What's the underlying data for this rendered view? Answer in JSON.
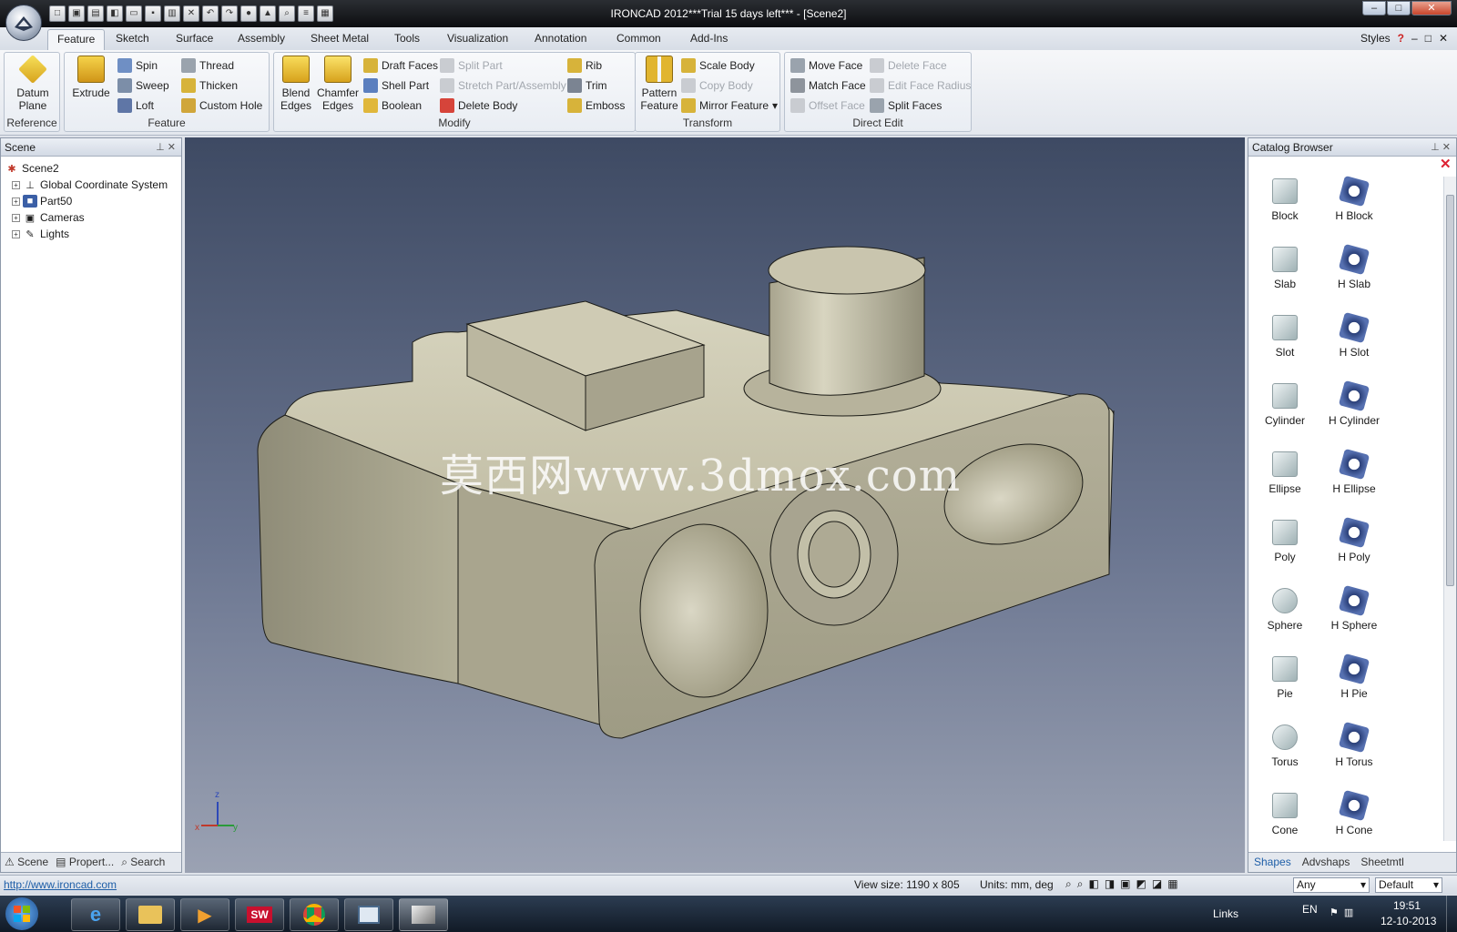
{
  "title_bar": {
    "title": "IRONCAD 2012***Trial 15 days left*** - [Scene2]"
  },
  "tabs": [
    "Feature",
    "Sketch",
    "Surface",
    "Assembly",
    "Sheet Metal",
    "Tools",
    "Visualization",
    "Annotation",
    "Common",
    "Add-Ins"
  ],
  "styles_label": "Styles",
  "ribbon": {
    "reference": {
      "label": "Reference",
      "datum1": "Datum",
      "datum2": "Plane"
    },
    "feature": {
      "label": "Feature",
      "extrude": "Extrude",
      "spin": "Spin",
      "sweep": "Sweep",
      "loft": "Loft",
      "thread": "Thread",
      "thicken": "Thicken",
      "custom_hole": "Custom Hole"
    },
    "modify": {
      "label": "Modify",
      "blend1": "Blend",
      "blend2": "Edges",
      "chamfer1": "Chamfer",
      "chamfer2": "Edges",
      "draft_faces": "Draft Faces",
      "shell_part": "Shell Part",
      "boolean": "Boolean",
      "split_part": "Split Part",
      "stretch": "Stretch Part/Assembly",
      "delete_body": "Delete Body",
      "rib": "Rib",
      "trim": "Trim",
      "emboss": "Emboss"
    },
    "transform": {
      "label": "Transform",
      "pattern1": "Pattern",
      "pattern2": "Feature",
      "scale_body": "Scale Body",
      "copy_body": "Copy Body",
      "mirror": "Mirror Feature"
    },
    "direct_edit": {
      "label": "Direct Edit",
      "move_face": "Move Face",
      "match_face": "Match Face",
      "offset_face": "Offset Face",
      "delete_face": "Delete Face",
      "edit_radius": "Edit Face Radius",
      "split_faces": "Split Faces"
    }
  },
  "scene_panel": {
    "title": "Scene",
    "tree": {
      "root": "Scene2",
      "children": [
        "Global Coordinate System",
        "Part50",
        "Cameras",
        "Lights"
      ]
    },
    "tabs": [
      "Scene",
      "Propert...",
      "Search"
    ]
  },
  "viewport": {
    "watermark": "莫西网www.3dmox.com",
    "axis_z": "z",
    "axis_x": "x",
    "axis_y": "y"
  },
  "catalog": {
    "title": "Catalog Browser",
    "items": [
      [
        "Block",
        "H Block"
      ],
      [
        "Slab",
        "H Slab"
      ],
      [
        "Slot",
        "H Slot"
      ],
      [
        "Cylinder",
        "H Cylinder"
      ],
      [
        "Ellipse",
        "H Ellipse"
      ],
      [
        "Poly",
        "H Poly"
      ],
      [
        "Sphere",
        "H Sphere"
      ],
      [
        "Pie",
        "H Pie"
      ],
      [
        "Torus",
        "H Torus"
      ],
      [
        "Cone",
        "H Cone"
      ]
    ],
    "tabs": [
      "Shapes",
      "Advshaps",
      "Sheetmtl"
    ]
  },
  "statusbar": {
    "url": "http://www.ironcad.com",
    "view_size": "View size: 1190 x 805",
    "units": "Units: mm, deg",
    "select_any": "Any",
    "select_default": "Default"
  },
  "taskbar": {
    "links": "Links",
    "lang": "EN",
    "time": "19:51",
    "date": "12-10-2013"
  },
  "colors": {
    "ribbon_bg": "#e7ebf1",
    "viewport_top": "#3e4a63",
    "viewport_bottom": "#9ba2b3",
    "part": "#b8b49a",
    "accent": "#1f5fa8"
  }
}
